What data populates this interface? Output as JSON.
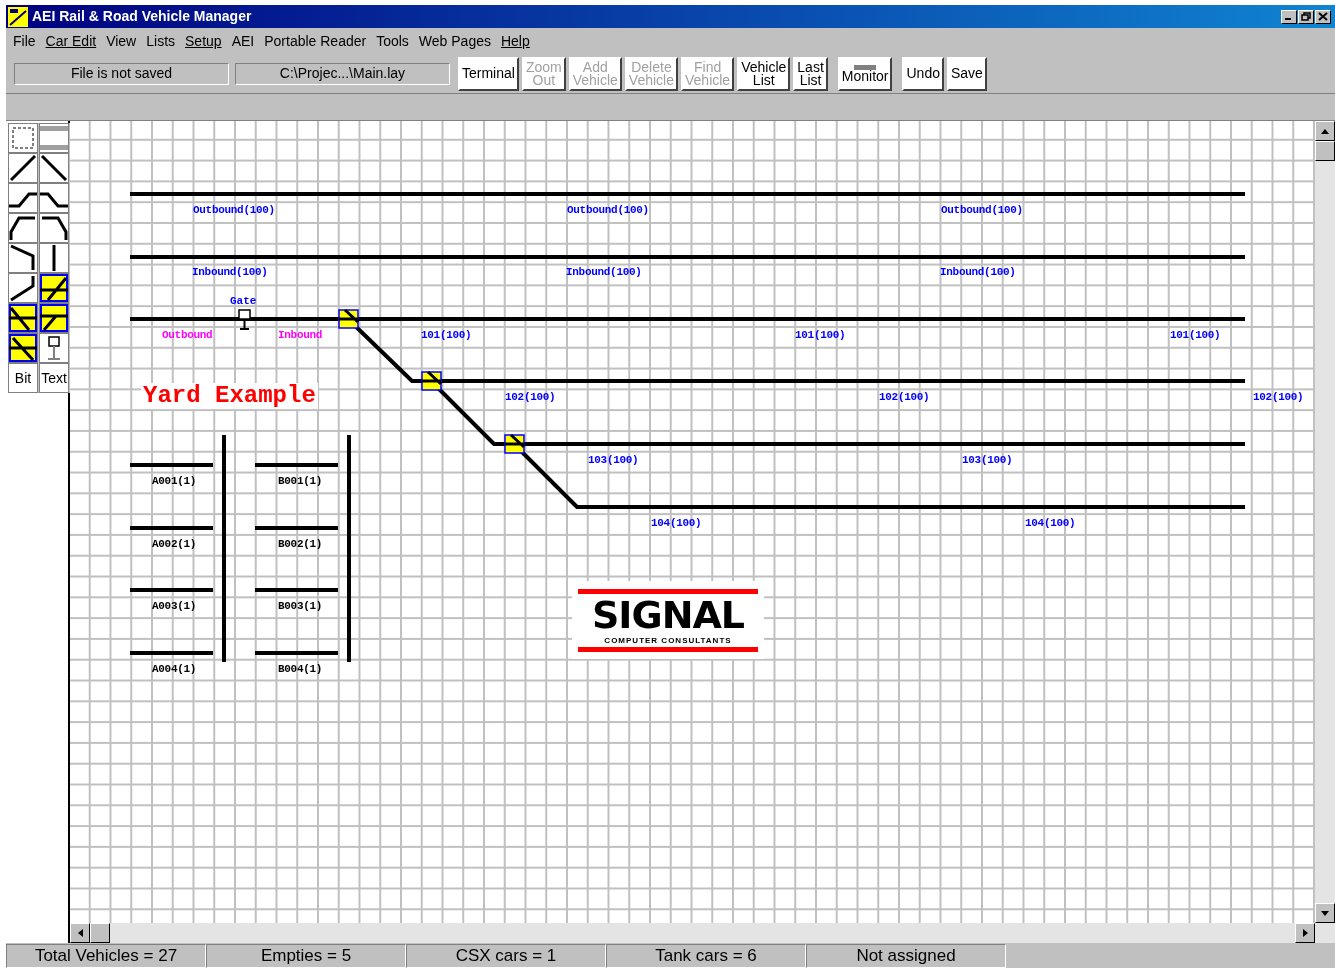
{
  "window": {
    "title": "AEI Rail & Road Vehicle Manager"
  },
  "menu": [
    {
      "label": "File",
      "underlined": false
    },
    {
      "label": "Car Edit",
      "underlined": true
    },
    {
      "label": "View",
      "underlined": false
    },
    {
      "label": "Lists",
      "underlined": false
    },
    {
      "label": "Setup",
      "underlined": true
    },
    {
      "label": "AEI",
      "underlined": false
    },
    {
      "label": "Portable Reader",
      "underlined": false
    },
    {
      "label": "Tools",
      "underlined": false
    },
    {
      "label": "Web Pages",
      "underlined": false
    },
    {
      "label": "Help",
      "underlined": true
    }
  ],
  "toolbar": {
    "status_fields": [
      "File is not saved",
      "C:\\Projec...\\Main.lay"
    ],
    "buttons": [
      {
        "kind": "text",
        "lines": [
          "Terminal"
        ],
        "disabled": false
      },
      {
        "kind": "text",
        "lines": [
          "Zoom",
          "Out"
        ],
        "disabled": true
      },
      {
        "kind": "text",
        "lines": [
          "Add",
          "Vehicle"
        ],
        "disabled": true
      },
      {
        "kind": "text",
        "lines": [
          "Delete",
          "Vehicle"
        ],
        "disabled": true
      },
      {
        "kind": "text",
        "lines": [
          "Find",
          "Vehicle"
        ],
        "disabled": true
      },
      {
        "kind": "text",
        "lines": [
          "Vehicle",
          "List"
        ],
        "disabled": false
      },
      {
        "kind": "text",
        "lines": [
          "Last",
          "List"
        ],
        "disabled": false
      },
      {
        "kind": "icon",
        "lines": [
          "Monitor"
        ],
        "disabled": false
      },
      {
        "kind": "text",
        "lines": [
          "Undo"
        ],
        "disabled": false
      },
      {
        "kind": "text",
        "lines": [
          "Save"
        ],
        "disabled": false
      }
    ]
  },
  "palette": {
    "buttons": [
      "Bit",
      "Text"
    ]
  },
  "layout": {
    "title": "Yard Example",
    "gate_label": "Gate",
    "track_labels": [
      {
        "text": "Outbound(100)",
        "color": "#0000ff"
      },
      {
        "text": "Outbound(100)",
        "color": "#0000ff"
      },
      {
        "text": "Outbound(100)",
        "color": "#0000ff"
      },
      {
        "text": "Inbound(100)",
        "color": "#0000ff"
      },
      {
        "text": "Inbound(100)",
        "color": "#0000ff"
      },
      {
        "text": "Inbound(100)",
        "color": "#0000ff"
      },
      {
        "text": "Outbound",
        "color": "#ff00ff"
      },
      {
        "text": "Inbound",
        "color": "#ff00ff"
      },
      {
        "text": "101(100)",
        "color": "#0000ff"
      },
      {
        "text": "101(100)",
        "color": "#0000ff"
      },
      {
        "text": "101(100)",
        "color": "#0000ff"
      },
      {
        "text": "102(100)",
        "color": "#0000ff"
      },
      {
        "text": "102(100)",
        "color": "#0000ff"
      },
      {
        "text": "102(100)",
        "color": "#0000ff"
      },
      {
        "text": "103(100)",
        "color": "#0000ff"
      },
      {
        "text": "103(100)",
        "color": "#0000ff"
      },
      {
        "text": "104(100)",
        "color": "#0000ff"
      },
      {
        "text": "104(100)",
        "color": "#0000ff"
      },
      {
        "text": "A001(1)",
        "color": "#000000"
      },
      {
        "text": "A002(1)",
        "color": "#000000"
      },
      {
        "text": "A003(1)",
        "color": "#000000"
      },
      {
        "text": "A004(1)",
        "color": "#000000"
      },
      {
        "text": "B001(1)",
        "color": "#000000"
      },
      {
        "text": "B002(1)",
        "color": "#000000"
      },
      {
        "text": "B003(1)",
        "color": "#000000"
      },
      {
        "text": "B004(1)",
        "color": "#000000"
      }
    ]
  },
  "logo": {
    "name": "SIGNAL",
    "tagline": "COMPUTER CONSULTANTS"
  },
  "status_bar": [
    "Total Vehicles = 27",
    "Empties = 5",
    "CSX cars = 1",
    "Tank cars = 6",
    "Not assigned"
  ]
}
